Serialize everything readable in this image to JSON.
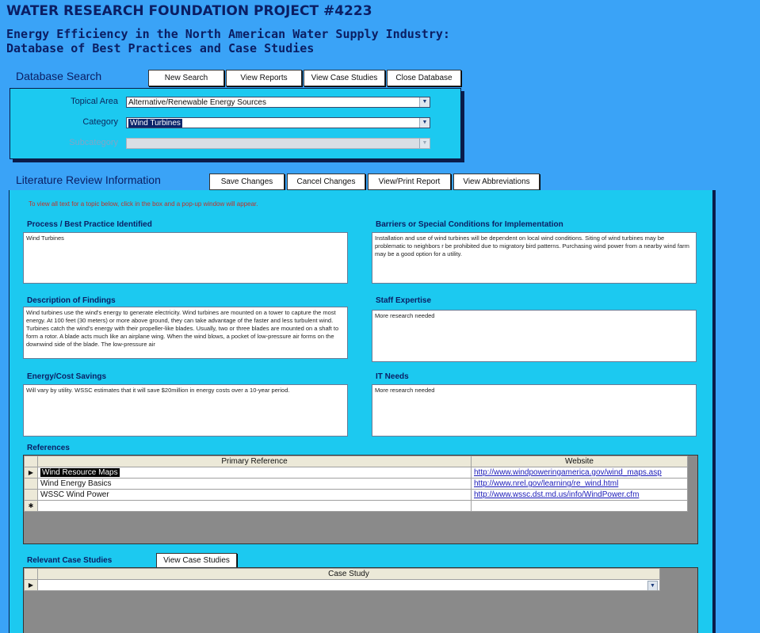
{
  "header": {
    "title": "WATER RESEARCH FOUNDATION PROJECT #4223",
    "subtitle_line1": "Energy Efficiency in the North American Water Supply Industry:",
    "subtitle_line2": "Database of Best Practices and Case Studies"
  },
  "search": {
    "label": "Database Search",
    "buttons": {
      "new_search": "New Search",
      "view_reports": "View Reports",
      "view_case_studies": "View Case Studies",
      "close_database": "Close Database"
    },
    "topical_area_label": "Topical Area",
    "topical_area_value": "Alternative/Renewable Energy Sources",
    "category_label": "Category",
    "category_value": "Wind Turbines",
    "subcategory_label": "Subcategory",
    "subcategory_value": ""
  },
  "literature": {
    "label": "Literature Review Information",
    "buttons": {
      "save_changes": "Save Changes",
      "cancel_changes": "Cancel Changes",
      "view_print_report": "View/Print Report",
      "view_abbreviations": "View Abbreviations"
    },
    "hint": "To view all text for a topic below, click in the box and a pop-up window will appear.",
    "process_title": "Process / Best Practice Identified",
    "process_text": "Wind Turbines",
    "barriers_title": "Barriers or Special Conditions for Implementation",
    "barriers_text": "Installation and use of wind turbines will be dependent on local wind conditions.  Siting of wind turbines may be problematic to neighbors r be prohibited due to migratory bird patterns.  Purchasing wind power from a nearby wind farm may be a good option for a utility.",
    "description_title": "Description of Findings",
    "description_text": "Wind turbines use the wind's energy to generate electricity.  Wind turbines are mounted on a tower to capture the most energy. At 100 feet (30 meters) or more above ground, they can take advantage of the faster and less turbulent wind. Turbines catch the wind's energy with their propeller-like blades. Usually, two or three blades are mounted on a shaft to form a rotor.  A blade acts much like an airplane wing. When the wind blows, a pocket of low-pressure air forms on the downwind side of the blade. The low-pressure air",
    "staff_title": "Staff Expertise",
    "staff_text": "More research needed",
    "savings_title": "Energy/Cost Savings",
    "savings_text": "Will vary by utility.  WSSC estimates that it will save $20million in energy costs over a 10-year period.",
    "it_title": "IT Needs",
    "it_text": "More research needed"
  },
  "references": {
    "label": "References",
    "col_primary": "Primary Reference",
    "col_website": "Website",
    "rows": [
      {
        "primary": "Wind Resource Maps",
        "website": "http://www.windpoweringamerica.gov/wind_maps.asp"
      },
      {
        "primary": "Wind Energy Basics",
        "website": "http://www.nrel.gov/learning/re_wind.html"
      },
      {
        "primary": "WSSC Wind Power",
        "website": "http://www.wssc.dst.md.us/info/WindPower.cfm"
      }
    ]
  },
  "case_studies": {
    "label": "Relevant Case Studies",
    "button": "View Case Studies",
    "col_case": "Case Study"
  },
  "icons": {
    "record_pointer": "record-pointer-icon",
    "new_record": "new-record-icon",
    "dropdown": "chevron-down-icon"
  }
}
